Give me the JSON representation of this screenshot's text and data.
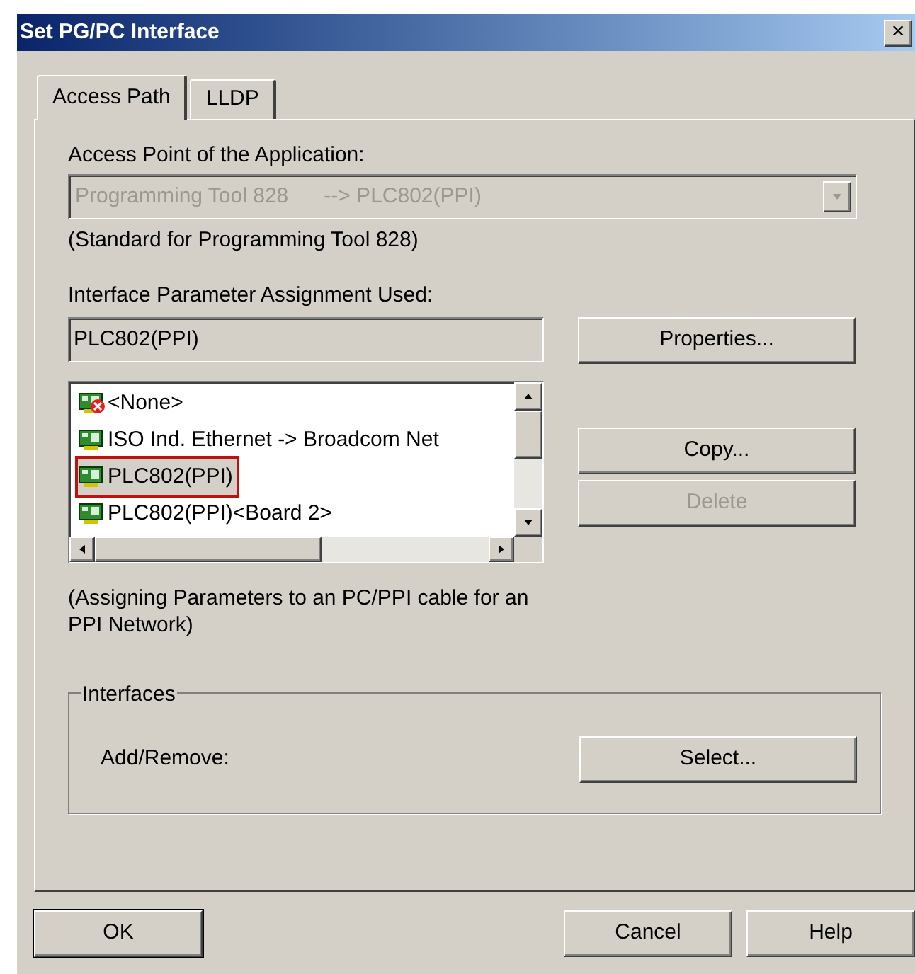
{
  "window": {
    "title": "Set PG/PC Interface",
    "close": "×"
  },
  "tabs": [
    {
      "label": "Access Path",
      "selected": true
    },
    {
      "label": "LLDP",
      "selected": false
    }
  ],
  "access_point": {
    "label": "Access Point of the Application:",
    "value": "Programming Tool 828      --> PLC802(PPI)",
    "disabled": true,
    "note": "(Standard for Programming Tool 828)"
  },
  "parameter_assignment": {
    "label": "Interface Parameter Assignment Used:",
    "value": "PLC802(PPI)"
  },
  "interface_list": [
    {
      "label": "<None>",
      "kind": "none",
      "selected": false
    },
    {
      "label": "ISO Ind. Ethernet -> Broadcom Net",
      "kind": "adapter",
      "selected": false
    },
    {
      "label": "PLC802(PPI)",
      "kind": "adapter",
      "selected": true
    },
    {
      "label": "PLC802(PPI)<Board 2>",
      "kind": "adapter",
      "selected": false
    }
  ],
  "side_buttons": [
    {
      "label": "Properties...",
      "disabled": false
    },
    {
      "label": "Copy...",
      "disabled": false
    },
    {
      "label": "Delete",
      "disabled": true
    }
  ],
  "description": "(Assigning Parameters to an PC/PPI cable for an PPI Network)",
  "interfaces": {
    "title": "Interfaces",
    "label": "Add/Remove:",
    "button": "Select..."
  },
  "buttons": [
    {
      "label": "OK",
      "default": true
    },
    {
      "label": "Cancel",
      "default": false
    },
    {
      "label": "Help",
      "default": false
    }
  ]
}
